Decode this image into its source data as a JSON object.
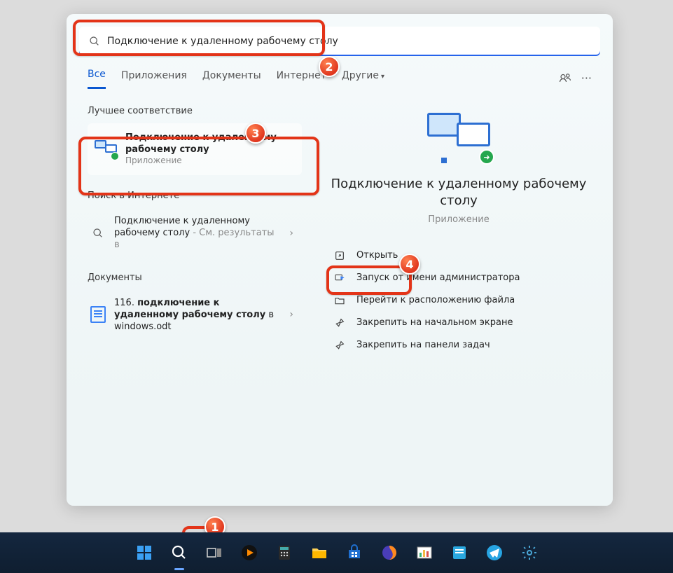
{
  "search_input": "Подключение к удаленному рабочему столу",
  "tabs": {
    "all": "Все",
    "apps": "Приложения",
    "docs": "Документы",
    "web": "Интернет",
    "more": "Другие"
  },
  "left": {
    "best_label": "Лучшее соответствие",
    "best_title": "Подключение к удаленному рабочему столу",
    "best_sub": "Приложение",
    "web_label": "Поиск в Интернете",
    "web_line1": "Подключение к удаленному рабочему столу",
    "web_line2_prefix": " - ",
    "web_line2": "См. результаты в",
    "docs_label": "Документы",
    "doc_prefix": "116. ",
    "doc_bold": "подключение к удаленному рабочему столу",
    "doc_suffix": " в windows.odt"
  },
  "preview": {
    "title": "Подключение к удаленному рабочему столу",
    "sub": "Приложение"
  },
  "actions": {
    "open": "Открыть",
    "admin": "Запуск от имени администратора",
    "location": "Перейти к расположению файла",
    "pin_start": "Закрепить на начальном экране",
    "pin_taskbar": "Закрепить на панели задач"
  },
  "callouts": {
    "n1": "1",
    "n2": "2",
    "n3": "3",
    "n4": "4"
  }
}
